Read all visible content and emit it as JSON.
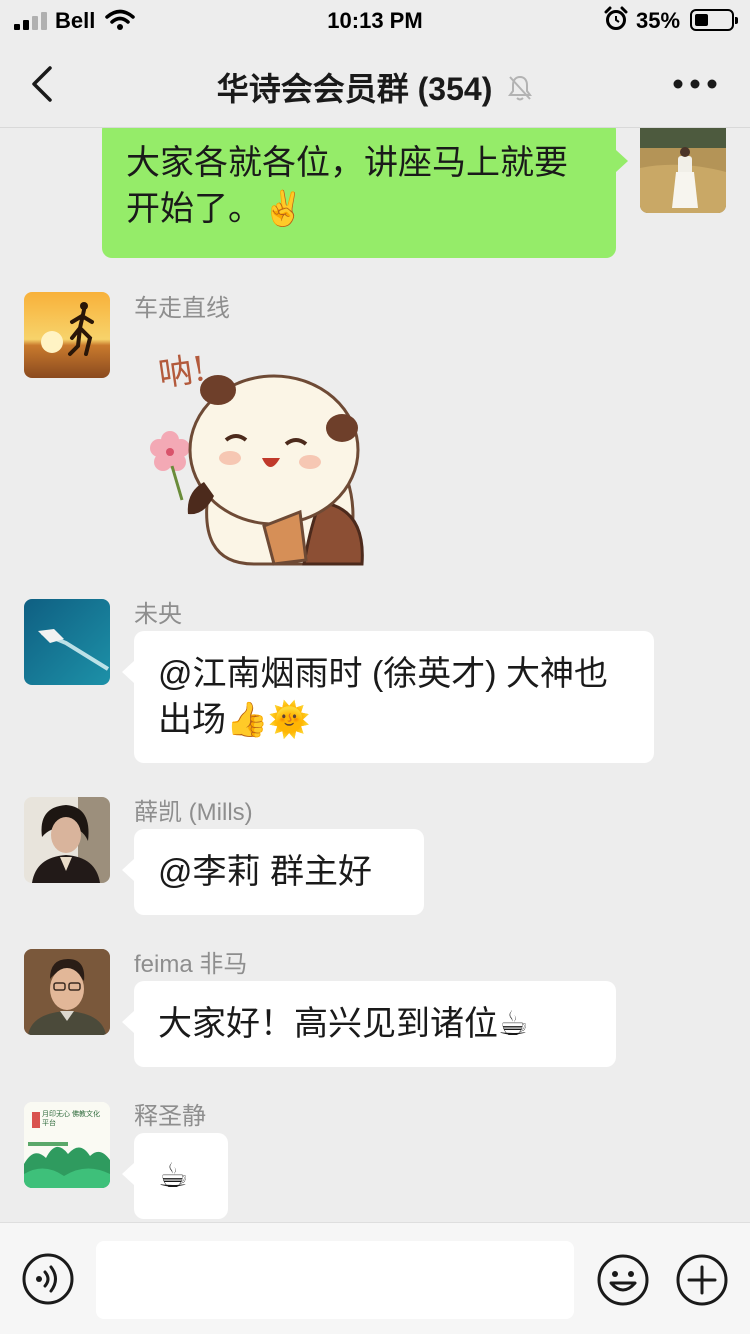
{
  "status_bar": {
    "carrier": "Bell",
    "time": "10:13 PM",
    "battery_percent": "35%",
    "battery_level": 0.35
  },
  "header": {
    "title": "华诗会会员群 (354)",
    "back_icon": "chevron-left-icon",
    "mute_icon": "bell-off-icon",
    "more_icon": "ellipsis-icon"
  },
  "messages": [
    {
      "sender": "self",
      "type": "text",
      "text": "大家各就各位，讲座马上就要开始了。✌️",
      "bubble_color": "#95ec69"
    },
    {
      "sender": "车走直线",
      "type": "sticker",
      "sticker_caption": "呐!",
      "sticker": "panda-with-flower-sticker"
    },
    {
      "sender": "未央",
      "type": "text",
      "text": "@江南烟雨时 (徐英才) 大神也出场👍🌞"
    },
    {
      "sender": "薛凯 (Mills)",
      "type": "text",
      "text": "@李莉 群主好"
    },
    {
      "sender": "feima 非马",
      "type": "text",
      "text": "大家好！高兴见到诸位☕"
    },
    {
      "sender": "释圣静",
      "type": "text",
      "text": "☕",
      "avatar_caption": "月印无心 佛教文化平台"
    }
  ],
  "input_bar": {
    "placeholder": "",
    "voice_icon": "voice-icon",
    "emoji_icon": "smiley-icon",
    "plus_icon": "plus-circle-icon"
  },
  "colors": {
    "background": "#ededed",
    "self_bubble": "#95ec69",
    "other_bubble": "#ffffff",
    "name_text": "#8e8e8e"
  }
}
